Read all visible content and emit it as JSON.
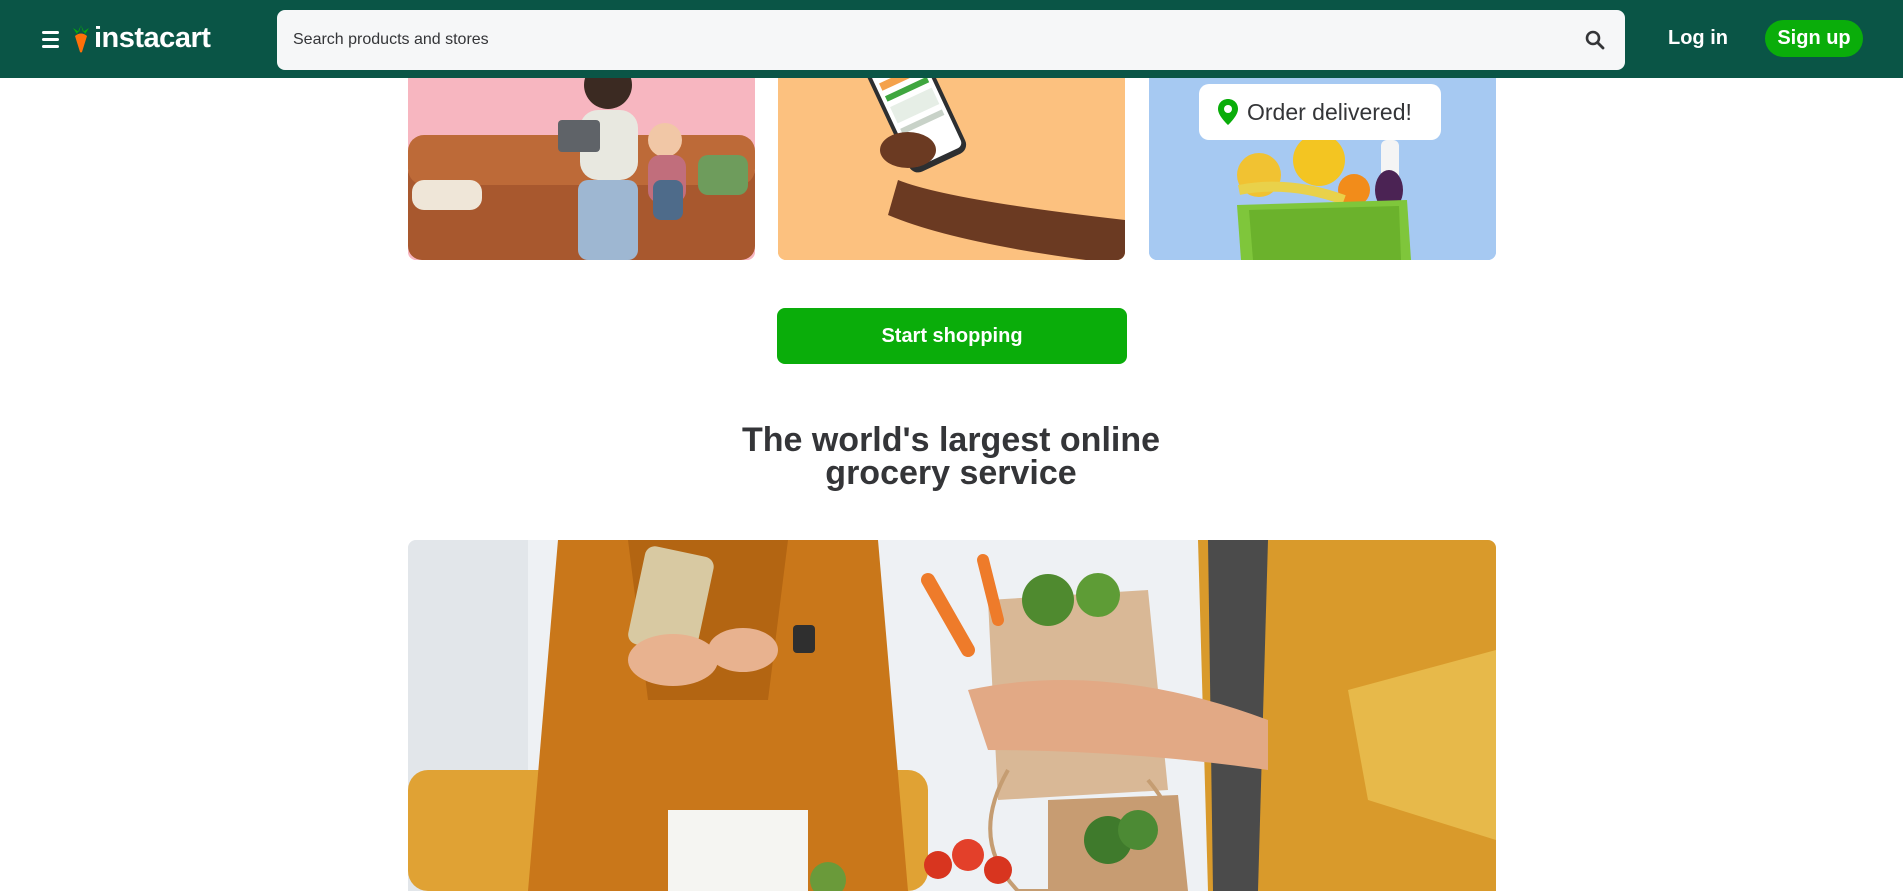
{
  "header": {
    "brand": "instacart",
    "search": {
      "placeholder": "Search products and stores",
      "value": ""
    },
    "login_label": "Log in",
    "signup_label": "Sign up"
  },
  "tiles": {
    "order_status": "Order delivered!"
  },
  "cta": {
    "label": "Start shopping"
  },
  "section": {
    "heading_line1": "The world's largest online",
    "heading_line2": "grocery service"
  },
  "colors": {
    "header_bg": "#0a5546",
    "brand_green": "#0aad0a",
    "carrot_orange": "#ff7009",
    "text": "#343538"
  },
  "icons": {
    "menu": "menu-icon",
    "logo": "carrot-logo-icon",
    "search": "search-icon",
    "location": "location-pin-icon"
  }
}
